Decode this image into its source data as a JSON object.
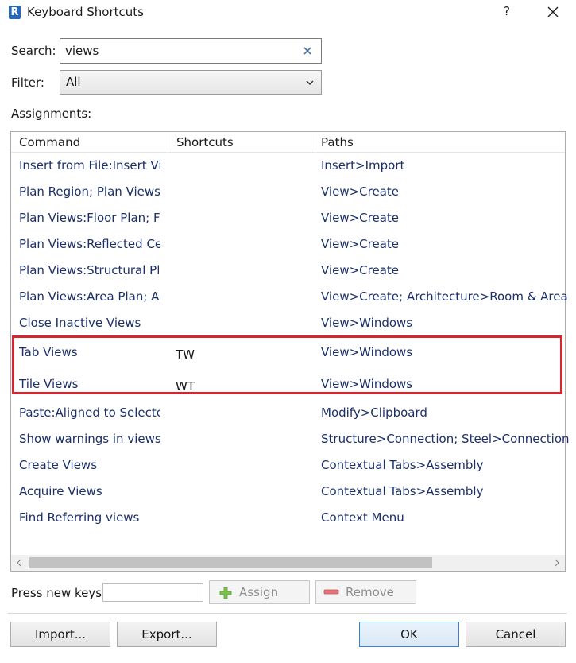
{
  "window": {
    "app_icon_letter": "R",
    "title": "Keyboard Shortcuts",
    "help_label": "?"
  },
  "search": {
    "label": "Search:",
    "value": "views"
  },
  "filter": {
    "label": "Filter:",
    "selected": "All"
  },
  "assignments_label": "Assignments:",
  "table": {
    "columns": [
      "Command",
      "Shortcuts",
      "Paths"
    ],
    "rows": [
      {
        "command": "Insert from File:Insert Vi...",
        "shortcut": "",
        "path": "Insert>Import"
      },
      {
        "command": "Plan Region; Plan Views:...",
        "shortcut": "",
        "path": "View>Create"
      },
      {
        "command": "Plan Views:Floor Plan; Fl...",
        "shortcut": "",
        "path": "View>Create"
      },
      {
        "command": "Plan Views:Reflected Cei...",
        "shortcut": "",
        "path": "View>Create"
      },
      {
        "command": "Plan Views:Structural Pla...",
        "shortcut": "",
        "path": "View>Create"
      },
      {
        "command": "Plan Views:Area Plan; Ar...",
        "shortcut": "",
        "path": "View>Create; Architecture>Room & Area"
      },
      {
        "command": "Close Inactive Views",
        "shortcut": "",
        "path": "View>Windows"
      },
      {
        "command": "Tab Views",
        "shortcut": "TW",
        "path": "View>Windows"
      },
      {
        "command": "Tile Views",
        "shortcut": "WT",
        "path": "View>Windows"
      },
      {
        "command": "Paste:Aligned to Selecte...",
        "shortcut": "",
        "path": "Modify>Clipboard"
      },
      {
        "command": "Show warnings in views",
        "shortcut": "",
        "path": "Structure>Connection; Steel>Connection"
      },
      {
        "command": "Create Views",
        "shortcut": "",
        "path": "Contextual Tabs>Assembly"
      },
      {
        "command": "Acquire Views",
        "shortcut": "",
        "path": "Contextual Tabs>Assembly"
      },
      {
        "command": "Find Referring views",
        "shortcut": "",
        "path": "Context Menu"
      }
    ]
  },
  "new_keys": {
    "label": "Press new keys:",
    "value": ""
  },
  "buttons": {
    "assign": "Assign",
    "remove": "Remove",
    "import": "Import...",
    "export": "Export...",
    "ok": "OK",
    "cancel": "Cancel"
  },
  "colors": {
    "command_text": "#1b2f6b",
    "highlight": "#d6252e",
    "assign_icon": "#7cc24e",
    "remove_icon": "#e8737a"
  },
  "icons": {
    "app": "revit-app-icon",
    "search_clear": "close-icon",
    "filter_dropdown": "chevron-down-icon",
    "assign": "plus-icon",
    "remove": "minus-icon"
  }
}
